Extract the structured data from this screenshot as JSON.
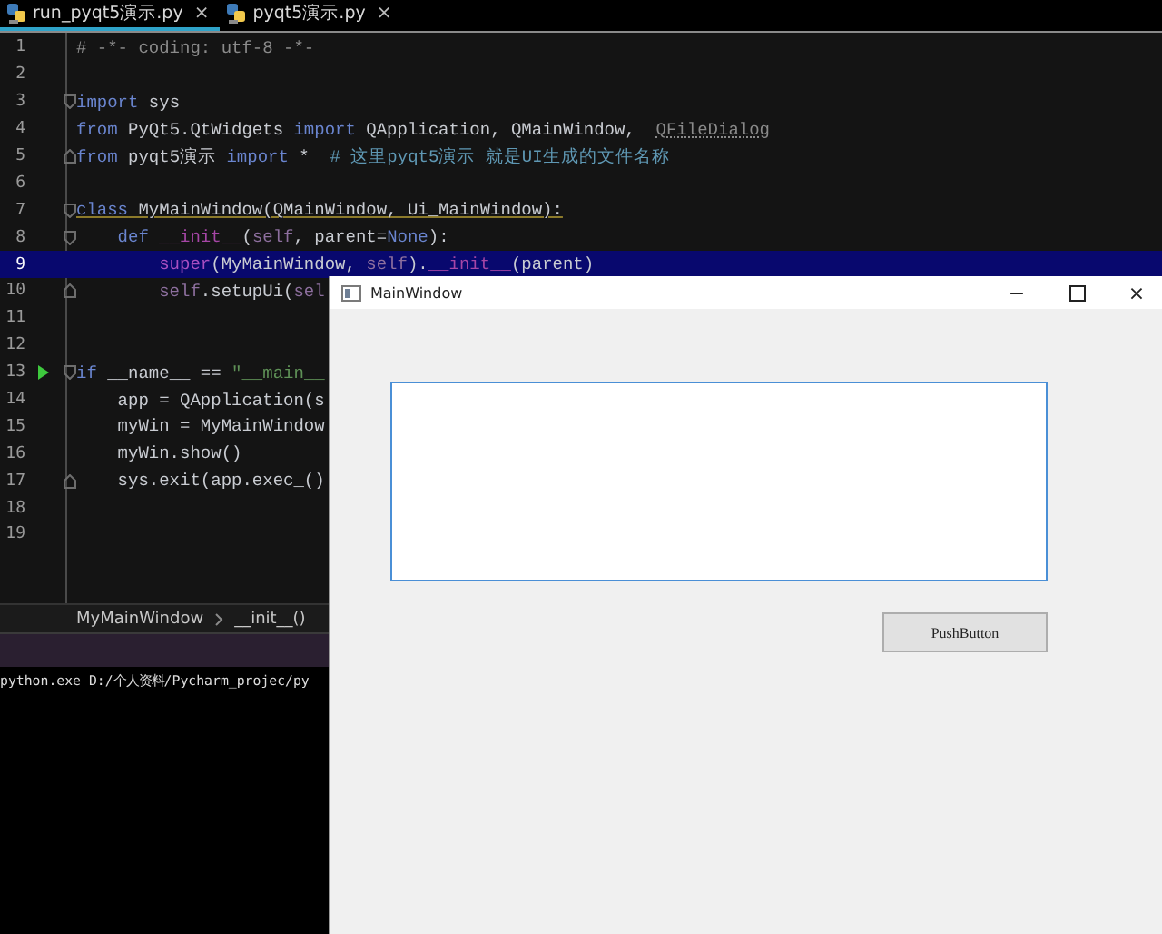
{
  "tabs": [
    {
      "label": "run_pyqt5演示.py",
      "selected": true,
      "close": "×"
    },
    {
      "label": "pyqt5演示.py",
      "selected": false,
      "close": "×"
    }
  ],
  "editor": {
    "lines": [
      {
        "number": "1",
        "selected": false,
        "run": false,
        "fold_start": false,
        "fold_end": false,
        "tokens": [
          {
            "kind": "comment",
            "text": "# -*- coding: utf-8 -*-"
          }
        ]
      },
      {
        "number": "2",
        "selected": false,
        "run": false,
        "fold_start": false,
        "fold_end": false
      },
      {
        "number": "3",
        "selected": false,
        "run": false,
        "fold_start": true,
        "fold_end": false,
        "tokens": [
          {
            "kind": "keyword",
            "text": "import"
          },
          {
            "kind": "plain",
            "text": " sys"
          }
        ]
      },
      {
        "number": "4",
        "selected": false,
        "run": false,
        "fold_start": false,
        "fold_end": false,
        "tokens": [
          {
            "kind": "keyword",
            "text": "from"
          },
          {
            "kind": "plain",
            "text": " PyQt5.QtWidgets "
          },
          {
            "kind": "keyword",
            "text": "import"
          },
          {
            "kind": "plain",
            "text": " QApplication, QMainWindow,  "
          },
          {
            "kind": "unused",
            "text": "QFileDialog"
          }
        ]
      },
      {
        "number": "5",
        "selected": false,
        "run": false,
        "fold_start": false,
        "fold_end": true,
        "tokens": [
          {
            "kind": "keyword",
            "text": "from"
          },
          {
            "kind": "plain",
            "text": " pyqt5演示 "
          },
          {
            "kind": "keyword",
            "text": "import"
          },
          {
            "kind": "plain",
            "text": " *  "
          },
          {
            "kind": "note",
            "text": "# 这里pyqt5演示 就是UI生成的文件名称"
          }
        ]
      },
      {
        "number": "6",
        "selected": false,
        "run": false,
        "fold_start": false,
        "fold_end": false
      },
      {
        "number": "7",
        "selected": false,
        "run": false,
        "fold_start": true,
        "fold_end": false,
        "tokens": [
          {
            "kind": "warn-keyword",
            "text": "class"
          },
          {
            "kind": "warn",
            "text": " MyMainWindow(QMainWindow, Ui_MainWindow):"
          }
        ]
      },
      {
        "number": "8",
        "selected": false,
        "run": false,
        "fold_start": true,
        "fold_end": false,
        "tokens": [
          {
            "kind": "keyword",
            "text": "    def"
          },
          {
            "kind": "dunder",
            "text": " __init__"
          },
          {
            "kind": "plain",
            "text": "("
          },
          {
            "kind": "self",
            "text": "self"
          },
          {
            "kind": "plain",
            "text": ", parent="
          },
          {
            "kind": "keyword",
            "text": "None"
          },
          {
            "kind": "plain",
            "text": "):"
          }
        ]
      },
      {
        "number": "9",
        "selected": true,
        "run": false,
        "fold_start": false,
        "fold_end": false,
        "tokens": [
          {
            "kind": "builtin",
            "text": "        super"
          },
          {
            "kind": "plain",
            "text": "(MyMainWindow, "
          },
          {
            "kind": "self",
            "text": "self"
          },
          {
            "kind": "plain",
            "text": ")."
          },
          {
            "kind": "dunder",
            "text": "__init__"
          },
          {
            "kind": "plain",
            "text": "(parent)"
          }
        ]
      },
      {
        "number": "10",
        "selected": false,
        "run": false,
        "fold_start": false,
        "fold_end": true,
        "tokens": [
          {
            "kind": "self",
            "text": "        self"
          },
          {
            "kind": "plain",
            "text": ".setupUi("
          },
          {
            "kind": "self",
            "text": "sel"
          }
        ]
      },
      {
        "number": "11",
        "selected": false,
        "run": false,
        "fold_start": false,
        "fold_end": false
      },
      {
        "number": "12",
        "selected": false,
        "run": false,
        "fold_start": false,
        "fold_end": false
      },
      {
        "number": "13",
        "selected": false,
        "run": true,
        "fold_start": true,
        "fold_end": false,
        "tokens": [
          {
            "kind": "keyword",
            "text": "if"
          },
          {
            "kind": "plain",
            "text": " __name__ == "
          },
          {
            "kind": "string",
            "text": "\"__main__"
          }
        ]
      },
      {
        "number": "14",
        "selected": false,
        "run": false,
        "fold_start": false,
        "fold_end": false,
        "tokens": [
          {
            "kind": "plain",
            "text": "    app = QApplication(s"
          }
        ]
      },
      {
        "number": "15",
        "selected": false,
        "run": false,
        "fold_start": false,
        "fold_end": false,
        "tokens": [
          {
            "kind": "plain",
            "text": "    myWin = MyMainWindow"
          }
        ]
      },
      {
        "number": "16",
        "selected": false,
        "run": false,
        "fold_start": false,
        "fold_end": false,
        "tokens": [
          {
            "kind": "plain",
            "text": "    myWin.show()"
          }
        ]
      },
      {
        "number": "17",
        "selected": false,
        "run": false,
        "fold_start": false,
        "fold_end": true,
        "tokens": [
          {
            "kind": "plain",
            "text": "    sys.exit(app.exec_()"
          }
        ]
      },
      {
        "number": "18",
        "selected": false,
        "run": false,
        "fold_start": false,
        "fold_end": false
      },
      {
        "number": "19",
        "selected": false,
        "run": false,
        "fold_start": false,
        "fold_end": false
      }
    ]
  },
  "breadcrumb": [
    "MyMainWindow",
    "__init__()"
  ],
  "console": {
    "lines": [
      "python.exe D:/个人资料/Pycharm_projec/py"
    ]
  },
  "window": {
    "title": "MainWindow",
    "minimize": "−",
    "close": "×",
    "button": "PushButton"
  }
}
